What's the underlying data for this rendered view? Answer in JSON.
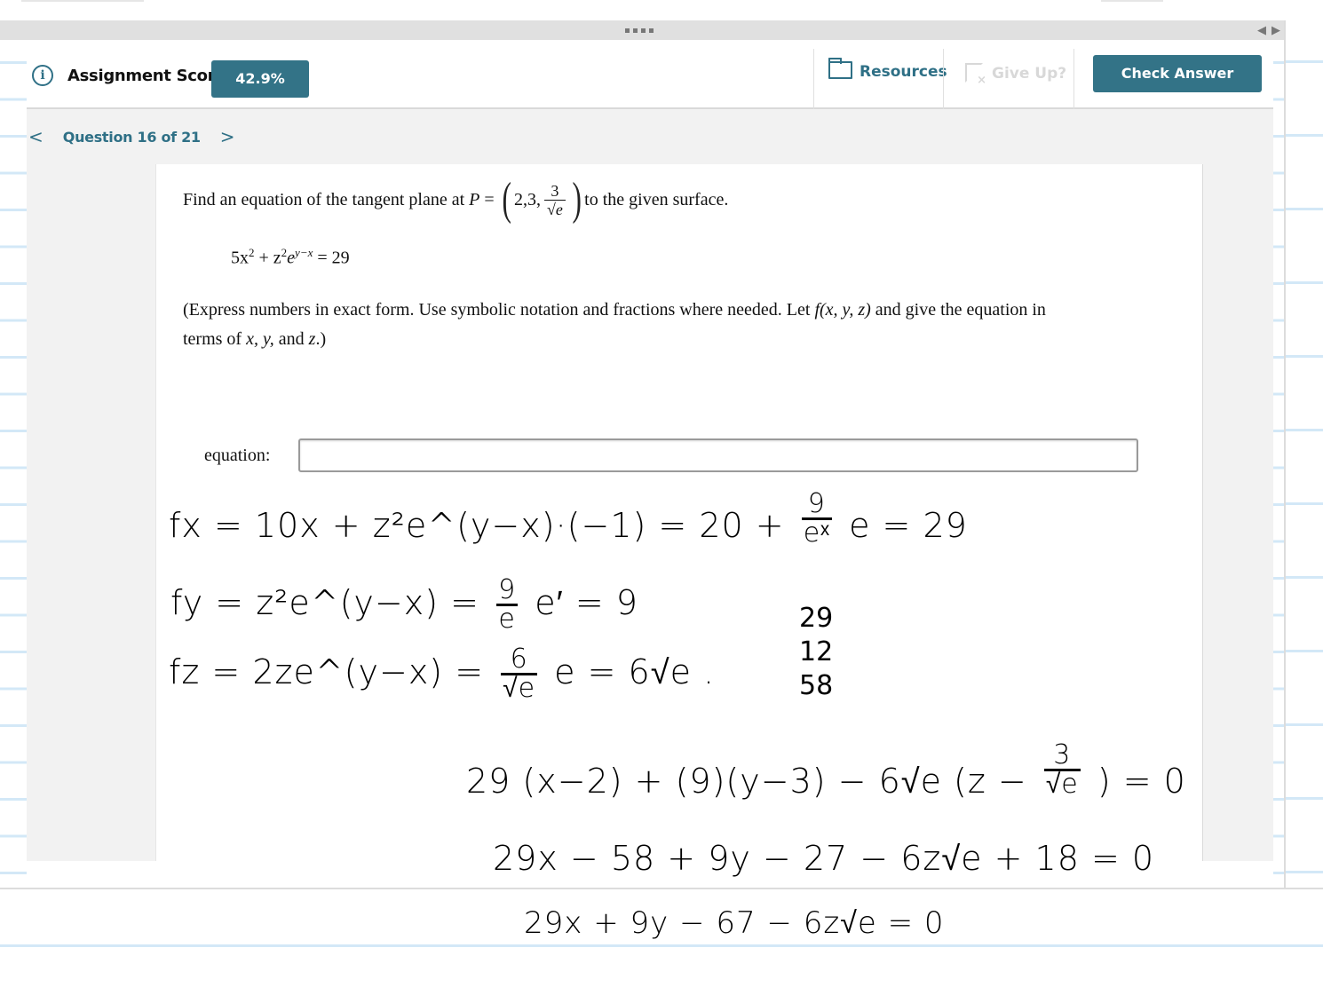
{
  "header": {
    "score_label": "Assignment Score:",
    "score_value": "42.9%",
    "resources_label": "Resources",
    "giveup_label": "Give Up?",
    "check_answer_label": "Check Answer"
  },
  "nav": {
    "question_label": "Question 16 of 21",
    "prev_glyph": "<",
    "next_glyph": ">"
  },
  "question": {
    "prompt_before": "Find an equation of the tangent plane at",
    "point_name": "P",
    "equals": "=",
    "point_coords": "2,3,",
    "point_z_num": "3",
    "point_z_den": "√e",
    "prompt_after": "to the given surface.",
    "surface_equation_parts": {
      "a": "5x",
      "a_exp": "2",
      "b": " + z",
      "b_exp": "2",
      "c": "e",
      "c_exp": "y−x",
      "rhs": " = 29"
    },
    "instructions_line1_start": "(Express numbers in exact form. Use symbolic notation and fractions where needed. Let ",
    "instructions_func": "f(x, y, z)",
    "instructions_line1_end": " and give the equation in",
    "instructions_line2_start": "terms of ",
    "instructions_vars": "x, y,",
    "instructions_and": " and ",
    "instructions_z": "z",
    "instructions_end": ".)"
  },
  "answer": {
    "label": "equation:",
    "value": "",
    "placeholder": ""
  },
  "handwriting": {
    "fx_line": "fx = 10x + z²e^(y−x)·(−1) = 20 +",
    "fx_frac_num": "9",
    "fx_frac_den": "eˣ",
    "fx_tail": "e  =  29",
    "fy_line": "fy = z²e^(y−x) =",
    "fy_frac_num": "9",
    "fy_frac_den": "e",
    "fy_tail": "e′  = 9",
    "fz_line": "fz = 2ze^(y−x) =",
    "fz_frac_num": "6",
    "fz_frac_den": "√e",
    "fz_tail": "e  = 6√e .",
    "side_calc": [
      "29",
      "12",
      "58"
    ],
    "plane_line1": "29 (x−2) + (9)(y−3) − 6√e (z −",
    "plane_line1_frac_num": "3",
    "plane_line1_frac_den": "√e",
    "plane_line1_end": ") = 0",
    "plane_line2": "29x − 58 + 9y − 27 −  6z√e  + 18  = 0",
    "plane_line3": "29x + 9y  −  67 − 6z√e = 0"
  },
  "colors": {
    "accent": "#337387",
    "accent_text": "#2f7086",
    "disabled": "#d8d8d8",
    "content_bg": "#f2f2f2",
    "ruled_line": "#d3e8f7"
  }
}
